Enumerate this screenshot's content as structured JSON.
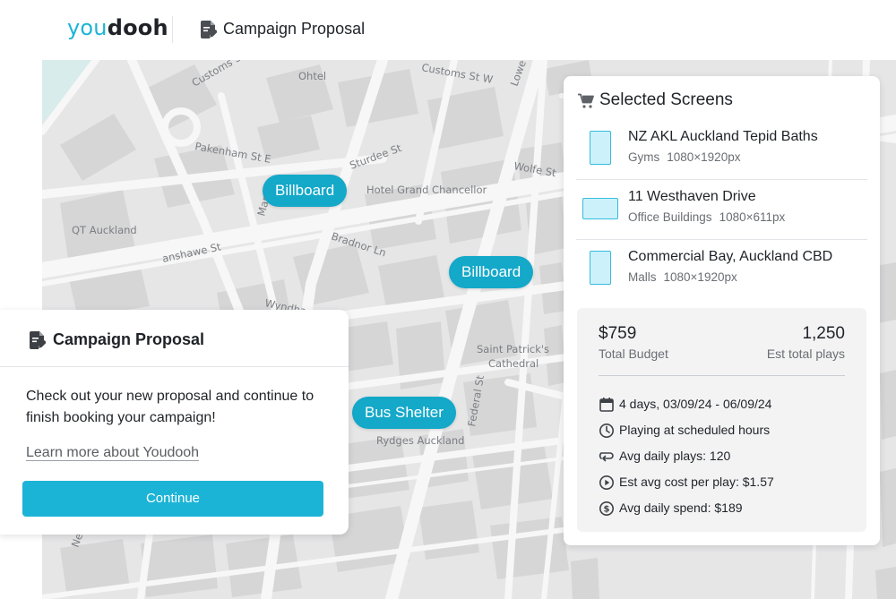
{
  "header": {
    "logo_you": "you",
    "logo_dooh": "dooh",
    "title": "Campaign Proposal"
  },
  "map": {
    "streets": [
      "Customs St W",
      "Ohtel",
      "Customs St",
      "Pakenham St E",
      "Sturdee St",
      "Wolfe St",
      "Hotel Grand Chancellor",
      "QT Auckland",
      "Bradnor Ln",
      "anshawe St",
      "Wyndha",
      "Saint Patrick's",
      "Cathedral",
      "Rydges Auckland",
      "Federal St",
      "Lowe",
      "Mar",
      "Ne"
    ],
    "pins": [
      {
        "label": "Billboard"
      },
      {
        "label": "Billboard"
      },
      {
        "label": "Bus Shelter"
      }
    ]
  },
  "proposal_card": {
    "title": "Campaign Proposal",
    "message": "Check out your new proposal and continue to finish booking your campaign!",
    "learn_more": "Learn more about Youdooh",
    "continue_label": "Continue"
  },
  "selected_screens": {
    "title": "Selected Screens",
    "items": [
      {
        "name": "NZ AKL Auckland Tepid Baths",
        "category": "Gyms",
        "resolution": "1080×1920px",
        "orientation": "portrait"
      },
      {
        "name": "11 Westhaven Drive",
        "category": "Office Buildings",
        "resolution": "1080×611px",
        "orientation": "landscape"
      },
      {
        "name": "Commercial Bay, Auckland CBD",
        "category": "Malls",
        "resolution": "1080×1920px",
        "orientation": "portrait"
      }
    ],
    "summary": {
      "budget": "$759",
      "budget_label": "Total Budget",
      "plays": "1,250",
      "plays_label": "Est total plays",
      "details": [
        {
          "icon": "calendar-icon",
          "text": "4 days, 03/09/24 - 06/09/24"
        },
        {
          "icon": "clock-icon",
          "text": "Playing at scheduled hours"
        },
        {
          "icon": "repeat-icon",
          "text": "Avg daily plays: 120"
        },
        {
          "icon": "play-circle-icon",
          "text": "Est avg cost per play: $1.57"
        },
        {
          "icon": "dollar-circle-icon",
          "text": "Avg daily spend: $189"
        }
      ]
    }
  },
  "colors": {
    "brand": "#1cb4d6",
    "pin": "#14a8c9",
    "map_background": "#e6e6e7",
    "map_road": "#f7f7f7",
    "thumb_fill": "#cdf1fb"
  }
}
